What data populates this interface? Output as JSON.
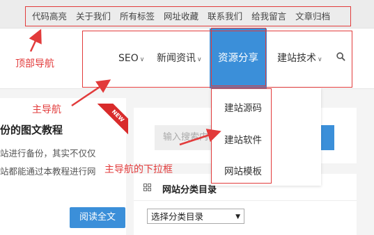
{
  "top_nav": {
    "items": [
      "代码高亮",
      "关于我们",
      "所有标签",
      "网址收藏",
      "联系我们",
      "给我留言",
      "文章归档"
    ]
  },
  "main_nav": {
    "seo": "SEO",
    "news": "新闻资讯",
    "resources": "资源分享",
    "build_tech": "建站技术"
  },
  "dropdown": {
    "items": [
      "建站源码",
      "建站软件",
      "网站模板"
    ]
  },
  "article": {
    "title": "份的图文教程",
    "line1": "站进行备份，其实不仅仅",
    "line2": "站都能通过本教程进行网",
    "read_more": "阅读全文",
    "badge": "NEW"
  },
  "sidebar": {
    "search_placeholder": "输入搜索内",
    "widget_title": "网站分类目录",
    "select_value": "选择分类目录"
  },
  "annotations": {
    "top_nav_label": "顶部导航",
    "main_nav_label": "主导航",
    "dropdown_label": "主导航的下拉框"
  },
  "colors": {
    "accent": "#3b8fd9",
    "annotation": "#e23b3b"
  }
}
